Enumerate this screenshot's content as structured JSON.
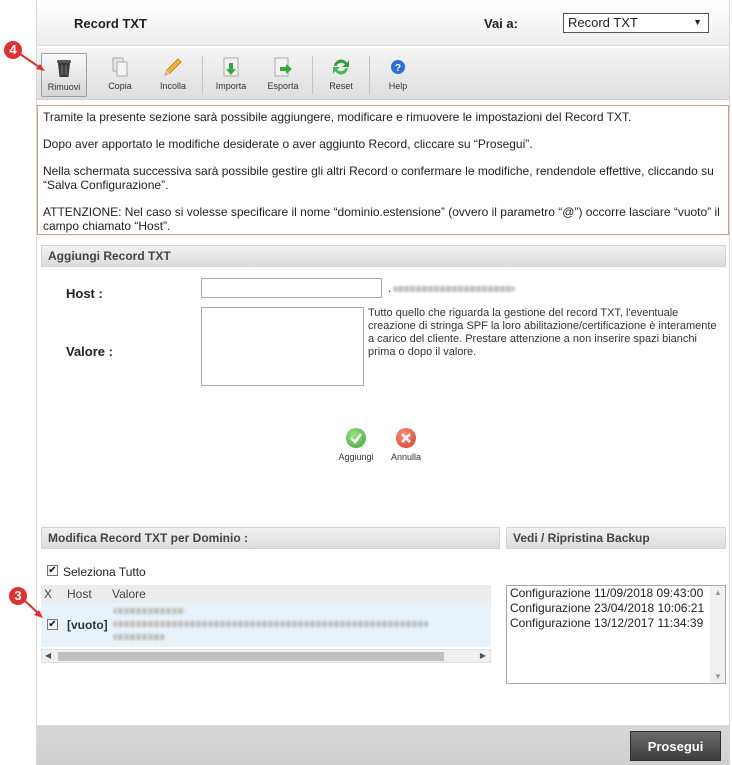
{
  "header": {
    "title": "Record TXT",
    "goto_label": "Vai a:",
    "goto_value": "Record TXT"
  },
  "toolbar": {
    "buttons": [
      {
        "label": "Rimuovi",
        "icon": "trash-icon"
      },
      {
        "label": "Copia",
        "icon": "copy-icon"
      },
      {
        "label": "Incolla",
        "icon": "pencil-icon"
      },
      {
        "label": "Importa",
        "icon": "import-icon"
      },
      {
        "label": "Esporta",
        "icon": "export-icon"
      },
      {
        "label": "Reset",
        "icon": "refresh-icon"
      },
      {
        "label": "Help",
        "icon": "help-icon"
      }
    ]
  },
  "markers": {
    "toolbar": "4",
    "row": "3"
  },
  "info": {
    "p1": "Tramite la presente sezione sarà possibile aggiungere, modificare e rimuovere le impostazioni del Record TXT.",
    "p2": "Dopo aver apportato le modifiche desiderate o aver aggiunto Record, cliccare su “Prosegui”.",
    "p3": "Nella schermata successiva sarà possibile gestire gli altri Record o confermare le modifiche, rendendole effettive, cliccando su “Salva Configurazione”.",
    "p4": "ATTENZIONE: Nel caso si volesse specificare il nome “dominio.estensione” (ovvero il parametro “@”) occorre lasciare “vuoto” il campo chiamato “Host”."
  },
  "add_section": {
    "title": "Aggiungi Record TXT",
    "host_label": "Host :",
    "host_value": "",
    "domain_dot": ".",
    "value_label": "Valore :",
    "value_text": "",
    "hint": "Tutto quello che riguarda la gestione del record TXT, l'eventuale creazione di stringa SPF la loro abilitazione/certificazione è interamente a carico del cliente. Prestare attenzione a non inserire spazi bianchi prima o dopo il valore.",
    "add_label": "Aggiungi",
    "cancel_label": "Annulla"
  },
  "edit_section": {
    "title": "Modifica Record TXT per Dominio :",
    "select_all_label": "Seleziona Tutto",
    "select_all_checked": true,
    "columns": [
      "X",
      "Host",
      "Valore"
    ],
    "rows": [
      {
        "checked": true,
        "host": "[vuoto]"
      }
    ]
  },
  "backup_section": {
    "title": "Vedi / Ripristina Backup",
    "items": [
      "Configurazione 11/09/2018 09:43:00",
      "Configurazione 23/04/2018 10:06:21",
      "Configurazione 13/12/2017 11:34:39"
    ]
  },
  "footer": {
    "proceed_label": "Prosegui"
  },
  "colors": {
    "marker": "#e23030",
    "info_border": "#c8a27a",
    "row_highlight": "#e7f2fa"
  }
}
